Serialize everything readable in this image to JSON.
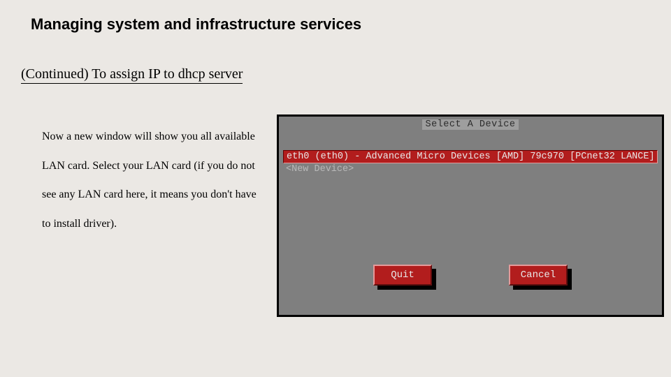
{
  "title": "Managing system and infrastructure services",
  "subtitle": "(Continued) To assign IP to dhcp server",
  "body": "Now a new window will show you all available LAN card. Select your LAN card (if you do not see any LAN card here, it means you don't have to install driver).",
  "terminal": {
    "heading": "Select A Device",
    "items": [
      {
        "label": "eth0 (eth0) - Advanced Micro Devices [AMD] 79c970 [PCnet32 LANCE]",
        "selected": true
      },
      {
        "label": "<New Device>",
        "selected": false
      }
    ],
    "buttons": {
      "quit": "Quit",
      "cancel": "Cancel"
    }
  }
}
